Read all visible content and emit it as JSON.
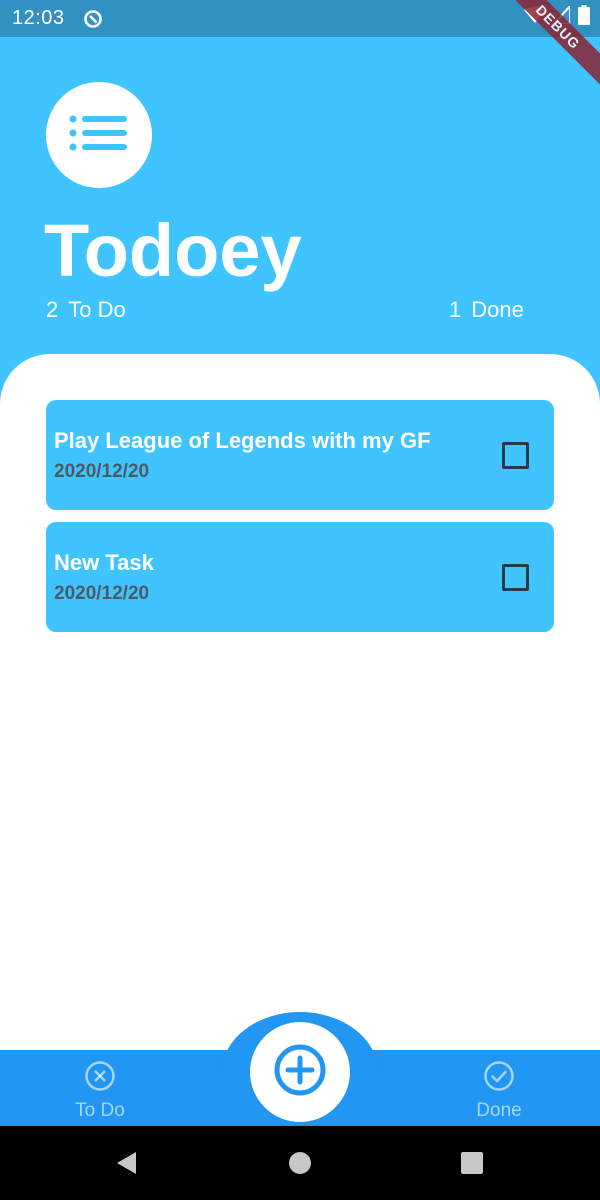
{
  "status_bar": {
    "time": "12:03",
    "icons": [
      "sync-icon",
      "wifi-icon",
      "signal-icon",
      "battery-icon"
    ],
    "debug_banner": "DEBUG"
  },
  "header": {
    "logo_icon": "list-icon",
    "title": "Todoey",
    "todo_count": "2",
    "todo_label": "To Do",
    "done_count": "1",
    "done_label": "Done"
  },
  "tasks": [
    {
      "title": "Play League of Legends with my GF",
      "date": "2020/12/20",
      "checked": false
    },
    {
      "title": "New Task",
      "date": "2020/12/20",
      "checked": false
    }
  ],
  "bottom_nav": {
    "todo_label": "To Do",
    "todo_icon": "close-circle-icon",
    "done_label": "Done",
    "done_icon": "check-circle-icon",
    "fab_icon": "add-circle-icon"
  },
  "system_nav": {
    "icons": [
      "back-icon",
      "home-icon",
      "recents-icon"
    ]
  },
  "colors": {
    "primary": "#40c4ff",
    "nav_bar": "#2196f3",
    "status_bar": "#3391c2",
    "date_text": "#4e5a63",
    "debug_ribbon": "#8b2434"
  }
}
